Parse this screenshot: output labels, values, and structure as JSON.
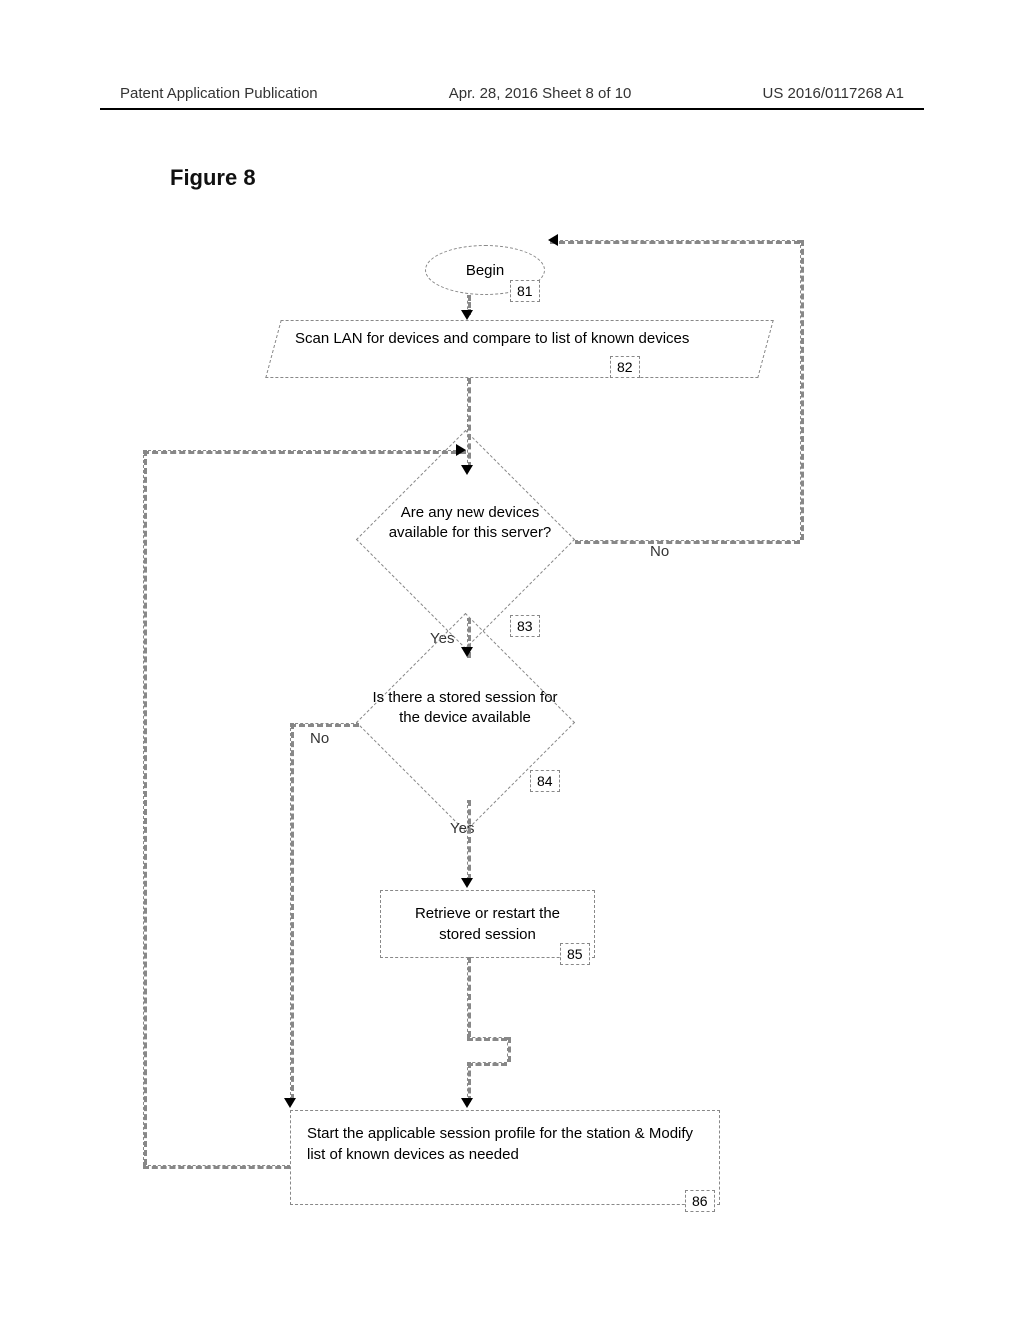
{
  "header": {
    "left": "Patent Application Publication",
    "center": "Apr. 28, 2016  Sheet 8 of 10",
    "right": "US 2016/0117268 A1"
  },
  "figure_title": "Figure 8",
  "flowchart": {
    "begin": {
      "text": "Begin",
      "ref": "81"
    },
    "scan": {
      "text": "Scan LAN for devices and compare to list of known devices",
      "ref": "82"
    },
    "decision1": {
      "text": "Are any new devices available for this server?",
      "ref": "83",
      "yes": "Yes",
      "no": "No"
    },
    "decision2": {
      "text": "Is there a stored session for the device available",
      "ref": "84",
      "yes": "Yes",
      "no": "No"
    },
    "retrieve": {
      "text": "Retrieve or restart the stored session",
      "ref": "85"
    },
    "start_profile": {
      "text": "Start the applicable session profile for the station & Modify list of known devices as needed",
      "ref": "86"
    }
  }
}
